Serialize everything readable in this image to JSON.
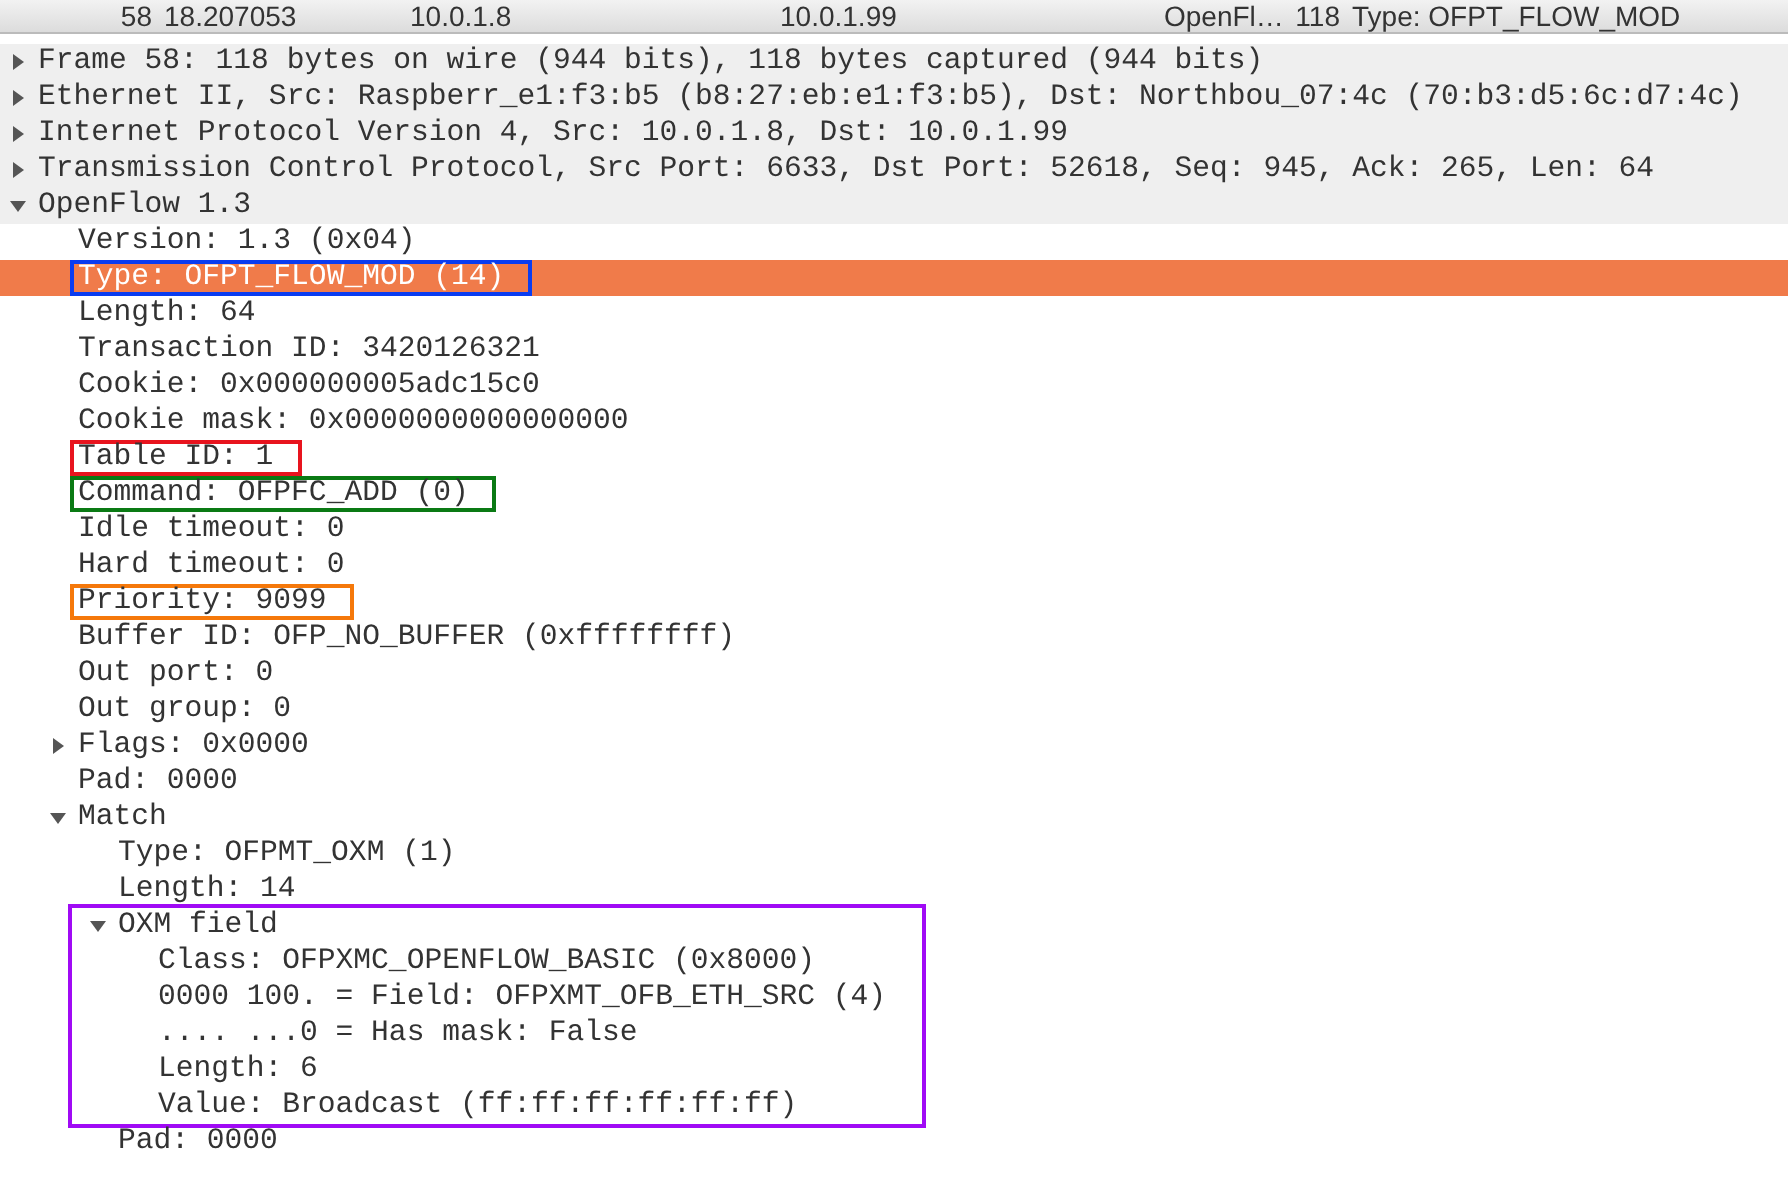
{
  "packet_list": {
    "row": {
      "selected": false,
      "cells": [
        "58",
        "18.207053",
        "10.0.1.8",
        "10.0.1.99",
        "OpenFl…",
        "118",
        "Type: OFPT_FLOW_MOD"
      ]
    }
  },
  "packet_details": [
    {
      "label": "Frame 58: 118 bytes on wire (944 bits), 118 bytes captured (944 bits)",
      "expanded": false,
      "selected": false
    },
    {
      "label": "Ethernet II, Src: Raspberr_e1:f3:b5 (b8:27:eb:e1:f3:b5), Dst: Northbou_07:4c (70:b3:d5:6c:d7:4c)",
      "expanded": false,
      "selected": false
    },
    {
      "label": "Internet Protocol Version 4, Src: 10.0.1.8, Dst: 10.0.1.99",
      "expanded": false,
      "selected": false
    },
    {
      "label": "Transmission Control Protocol, Src Port: 6633, Dst Port: 52618, Seq: 945, Ack: 265, Len: 64",
      "expanded": false,
      "selected": false
    },
    {
      "label": "OpenFlow 1.3",
      "expanded": true,
      "selected": false,
      "children": [
        {
          "label": "Version: 1.3 (0x04)",
          "selected": false
        },
        {
          "label": "Type: OFPT_FLOW_MOD (14)",
          "selected": true,
          "color": "#0a3cf0"
        },
        {
          "label": "Length: 64",
          "selected": false
        },
        {
          "label": "Transaction ID: 3420126321",
          "selected": false
        },
        {
          "label": "Cookie: 0x000000005adc15c0",
          "selected": false
        },
        {
          "label": "Cookie mask: 0x0000000000000000",
          "selected": false
        },
        {
          "label": "Table ID: 1",
          "selected": false,
          "color": "#e8141e"
        },
        {
          "label": "Command: OFPFC_ADD (0)",
          "selected": false,
          "color": "#0a7a14"
        },
        {
          "label": "Idle timeout: 0",
          "selected": false
        },
        {
          "label": "Hard timeout: 0",
          "selected": false
        },
        {
          "label": "Priority: 9099",
          "selected": false,
          "color": "#f5780a"
        },
        {
          "label": "Buffer ID: OFP_NO_BUFFER (0xffffffff)",
          "selected": false
        },
        {
          "label": "Out port: 0",
          "selected": false
        },
        {
          "label": "Out group: 0",
          "selected": false
        },
        {
          "label": "Flags: 0x0000",
          "expanded": false,
          "selected": false
        },
        {
          "label": "Pad: 0000",
          "selected": false
        },
        {
          "label": "Match",
          "expanded": true,
          "selected": false,
          "children": [
            {
              "label": "Type: OFPMT_OXM (1)",
              "selected": false
            },
            {
              "label": "Length: 14",
              "selected": false
            },
            {
              "label": "OXM field",
              "expanded": true,
              "selected": false,
              "color": "#a00af5",
              "children": [
                {
                  "label": "Class: OFPXMC_OPENFLOW_BASIC (0x8000)",
                  "selected": false
                },
                {
                  "label": "0000 100. = Field: OFPXMT_OFB_ETH_SRC (4)",
                  "selected": false
                },
                {
                  "label": ".... ...0 = Has mask: False",
                  "selected": false
                },
                {
                  "label": "Length: 6",
                  "selected": false
                },
                {
                  "label": "Value: Broadcast (ff:ff:ff:ff:ff:ff)",
                  "selected": false
                }
              ]
            },
            {
              "label": "Pad: 0000",
              "selected": false
            }
          ]
        }
      ]
    }
  ]
}
